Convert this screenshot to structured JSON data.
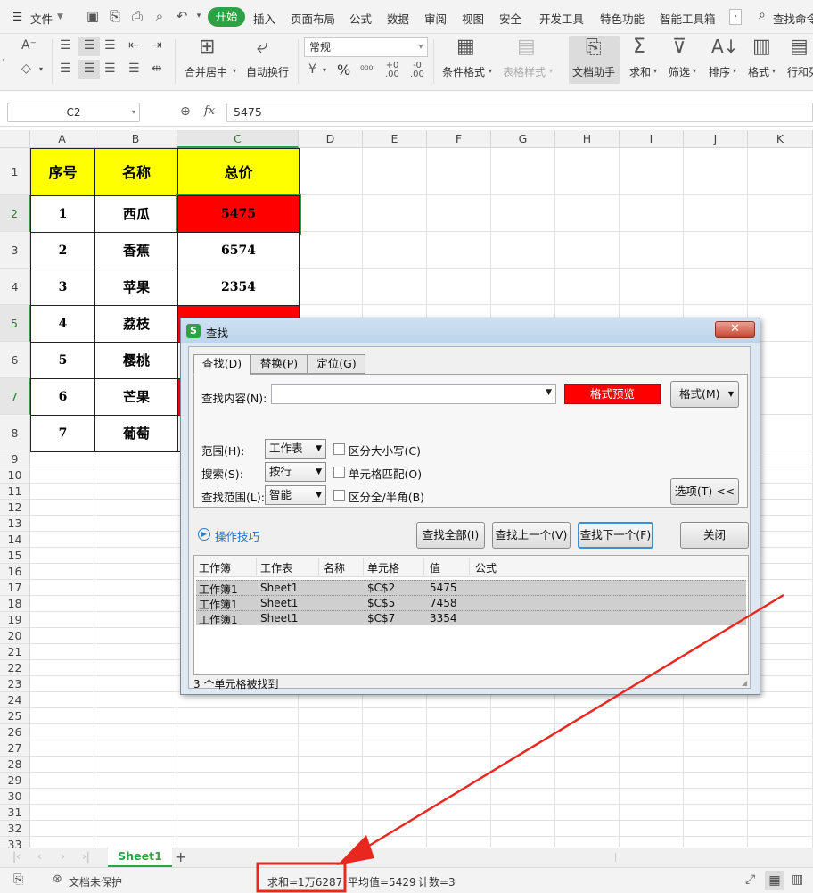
{
  "menubar": {
    "file_label": "文件",
    "tabs": [
      "开始",
      "插入",
      "页面布局",
      "公式",
      "数据",
      "审阅",
      "视图",
      "安全",
      "开发工具",
      "特色功能",
      "智能工具箱"
    ],
    "search_label": "查找命令"
  },
  "ribbon": {
    "merge_center": "合并居中",
    "wrap_text": "自动换行",
    "number_format": "常规",
    "percent": "%",
    "conditional_format": "条件格式",
    "table_style": "表格样式",
    "doc_assistant": "文档助手",
    "sum": "求和",
    "filter": "筛选",
    "sort": "排序",
    "format": "格式",
    "row_col": "行和列"
  },
  "formula_bar": {
    "name_box": "C2",
    "fx": "fx",
    "value": "5475"
  },
  "grid": {
    "columns": [
      "A",
      "B",
      "C",
      "D",
      "E",
      "F",
      "G",
      "H",
      "I",
      "J",
      "K"
    ],
    "rows": [
      "1",
      "2",
      "3",
      "4",
      "5",
      "6",
      "7",
      "8",
      "9",
      "10",
      "11",
      "12",
      "13",
      "14",
      "15",
      "16",
      "17",
      "18",
      "19",
      "20",
      "21",
      "22",
      "23",
      "24",
      "25",
      "26",
      "27",
      "28",
      "29",
      "30",
      "31",
      "32",
      "33"
    ],
    "headers": [
      "序号",
      "名称",
      "总价"
    ],
    "data": [
      [
        "1",
        "西瓜",
        "5475"
      ],
      [
        "2",
        "香蕉",
        "6574"
      ],
      [
        "3",
        "苹果",
        "2354"
      ],
      [
        "4",
        "荔枝",
        ""
      ],
      [
        "5",
        "樱桃",
        ""
      ],
      [
        "6",
        "芒果",
        ""
      ],
      [
        "7",
        "葡萄",
        ""
      ]
    ],
    "colors": {
      "header_fill": "#ffff00",
      "match_fill": "#ff0000"
    }
  },
  "dialog": {
    "title": "查找",
    "tabs": [
      "查找(D)",
      "替换(P)",
      "定位(G)"
    ],
    "find_label": "查找内容(N):",
    "find_value": "",
    "format_preview": "格式预览",
    "format_button": "格式(M)",
    "scope_label": "范围(H):",
    "scope_value": "工作表",
    "search_label": "搜索(S):",
    "search_value": "按行",
    "lookin_label": "查找范围(L):",
    "lookin_value": "智能",
    "match_case": "区分大小写(C)",
    "match_cell": "单元格匹配(O)",
    "match_width": "区分全/半角(B)",
    "options_button": "选项(T) <<",
    "tips_link": "操作技巧",
    "find_all": "查找全部(I)",
    "find_prev": "查找上一个(V)",
    "find_next": "查找下一个(F)",
    "close": "关闭",
    "results_columns": [
      "工作簿",
      "工作表",
      "名称",
      "单元格",
      "值",
      "公式"
    ],
    "results": [
      [
        "工作簿1",
        "Sheet1",
        "",
        "$C$2",
        "5475",
        ""
      ],
      [
        "工作簿1",
        "Sheet1",
        "",
        "$C$5",
        "7458",
        ""
      ],
      [
        "工作簿1",
        "Sheet1",
        "",
        "$C$7",
        "3354",
        ""
      ]
    ],
    "status": "3 个单元格被找到"
  },
  "sheet_tabs": {
    "active": "Sheet1",
    "add": "+"
  },
  "statusbar": {
    "protect": "文档未保护",
    "sum": "求和=1万6287",
    "average": "平均值=5429",
    "count": "计数=3"
  },
  "annotation_color": "#e8281e"
}
